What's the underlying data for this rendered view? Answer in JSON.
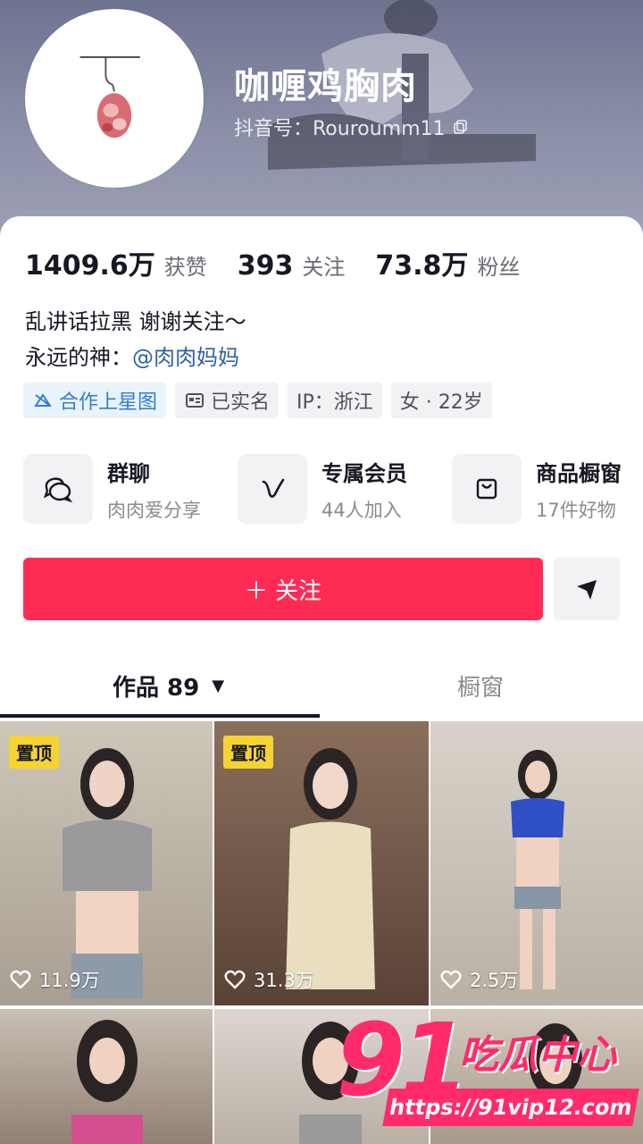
{
  "profile": {
    "nickname": "咖喱鸡胸肉",
    "douyin_id": "抖音号：Rouroumm11"
  },
  "stats": [
    {
      "num": "1409.6万",
      "label": "获赞"
    },
    {
      "num": "393",
      "label": "关注"
    },
    {
      "num": "73.8万",
      "label": "粉丝"
    }
  ],
  "bio": {
    "line1": "乱讲话拉黑 谢谢关注～",
    "line2_prefix": "永远的神：",
    "line2_mention": "@肉肉妈妈"
  },
  "tags": {
    "star": "合作上星图",
    "verified": "已实名",
    "ip": "IP：浙江",
    "gender_age": "女 · 22岁"
  },
  "features": [
    {
      "title": "群聊",
      "sub": "肉肉爱分享",
      "icon": "chat-bubbles-icon"
    },
    {
      "title": "专属会员",
      "sub": "44人加入",
      "icon": "v-icon"
    },
    {
      "title": "商品橱窗",
      "sub": "17件好物",
      "icon": "bag-icon"
    }
  ],
  "actions": {
    "follow": "＋ 关注"
  },
  "tabs": {
    "works": "作品 89",
    "window": "橱窗"
  },
  "grid": [
    {
      "pinned": "置顶",
      "likes": "11.9万"
    },
    {
      "pinned": "置顶",
      "likes": "31.3万"
    },
    {
      "pinned": "",
      "likes": "2.5万"
    },
    {
      "pinned": "",
      "likes": ""
    },
    {
      "pinned": "",
      "likes": ""
    },
    {
      "pinned": "",
      "likes": ""
    }
  ],
  "watermark": {
    "big": "91",
    "cn": "吃瓜中心",
    "url": "https://91vip12.com"
  },
  "colors": {
    "accent": "#fe2c55",
    "mention": "#2f5fa7",
    "pin": "#f5d331"
  }
}
